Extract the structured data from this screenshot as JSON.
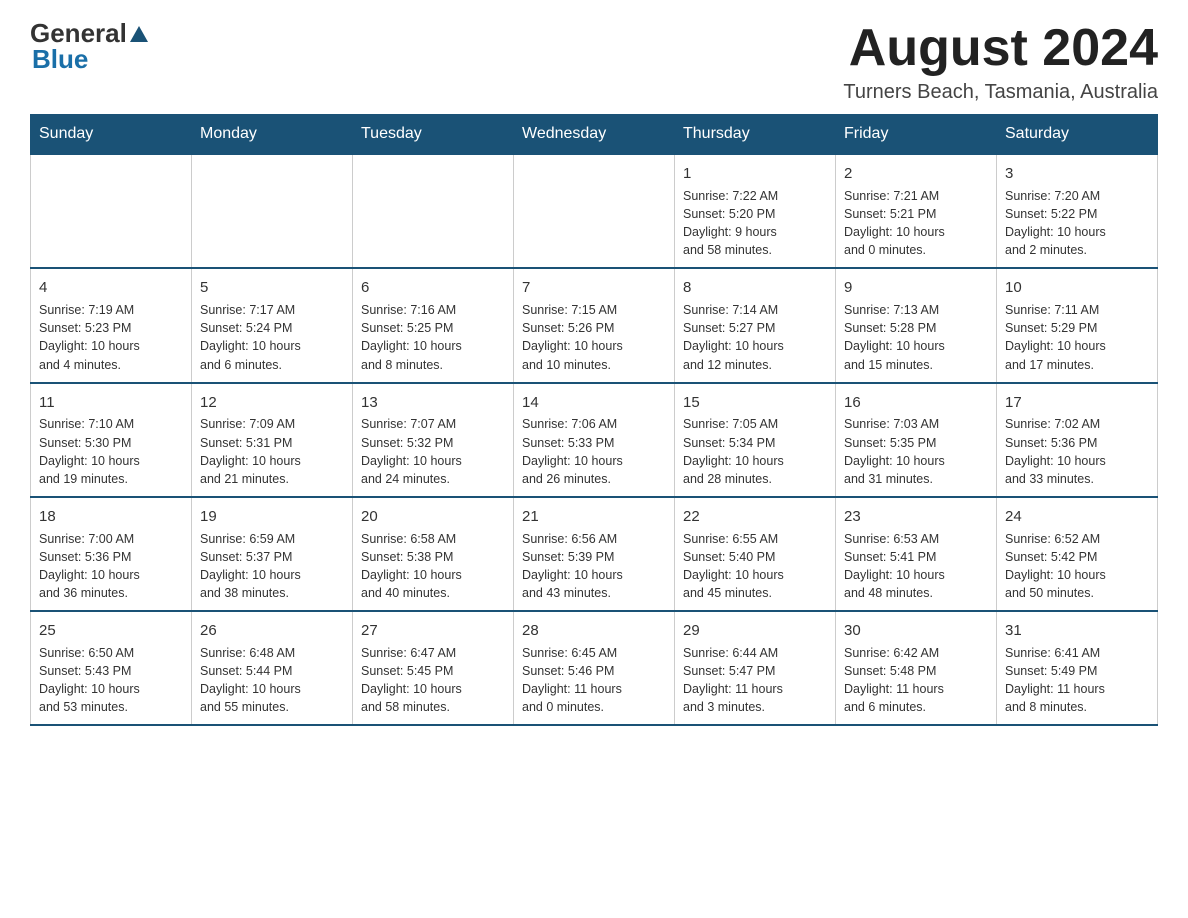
{
  "header": {
    "logo": {
      "general": "General",
      "blue": "Blue"
    },
    "title": "August 2024",
    "location": "Turners Beach, Tasmania, Australia"
  },
  "calendar": {
    "days_of_week": [
      "Sunday",
      "Monday",
      "Tuesday",
      "Wednesday",
      "Thursday",
      "Friday",
      "Saturday"
    ],
    "weeks": [
      [
        {
          "day": "",
          "info": ""
        },
        {
          "day": "",
          "info": ""
        },
        {
          "day": "",
          "info": ""
        },
        {
          "day": "",
          "info": ""
        },
        {
          "day": "1",
          "info": "Sunrise: 7:22 AM\nSunset: 5:20 PM\nDaylight: 9 hours\nand 58 minutes."
        },
        {
          "day": "2",
          "info": "Sunrise: 7:21 AM\nSunset: 5:21 PM\nDaylight: 10 hours\nand 0 minutes."
        },
        {
          "day": "3",
          "info": "Sunrise: 7:20 AM\nSunset: 5:22 PM\nDaylight: 10 hours\nand 2 minutes."
        }
      ],
      [
        {
          "day": "4",
          "info": "Sunrise: 7:19 AM\nSunset: 5:23 PM\nDaylight: 10 hours\nand 4 minutes."
        },
        {
          "day": "5",
          "info": "Sunrise: 7:17 AM\nSunset: 5:24 PM\nDaylight: 10 hours\nand 6 minutes."
        },
        {
          "day": "6",
          "info": "Sunrise: 7:16 AM\nSunset: 5:25 PM\nDaylight: 10 hours\nand 8 minutes."
        },
        {
          "day": "7",
          "info": "Sunrise: 7:15 AM\nSunset: 5:26 PM\nDaylight: 10 hours\nand 10 minutes."
        },
        {
          "day": "8",
          "info": "Sunrise: 7:14 AM\nSunset: 5:27 PM\nDaylight: 10 hours\nand 12 minutes."
        },
        {
          "day": "9",
          "info": "Sunrise: 7:13 AM\nSunset: 5:28 PM\nDaylight: 10 hours\nand 15 minutes."
        },
        {
          "day": "10",
          "info": "Sunrise: 7:11 AM\nSunset: 5:29 PM\nDaylight: 10 hours\nand 17 minutes."
        }
      ],
      [
        {
          "day": "11",
          "info": "Sunrise: 7:10 AM\nSunset: 5:30 PM\nDaylight: 10 hours\nand 19 minutes."
        },
        {
          "day": "12",
          "info": "Sunrise: 7:09 AM\nSunset: 5:31 PM\nDaylight: 10 hours\nand 21 minutes."
        },
        {
          "day": "13",
          "info": "Sunrise: 7:07 AM\nSunset: 5:32 PM\nDaylight: 10 hours\nand 24 minutes."
        },
        {
          "day": "14",
          "info": "Sunrise: 7:06 AM\nSunset: 5:33 PM\nDaylight: 10 hours\nand 26 minutes."
        },
        {
          "day": "15",
          "info": "Sunrise: 7:05 AM\nSunset: 5:34 PM\nDaylight: 10 hours\nand 28 minutes."
        },
        {
          "day": "16",
          "info": "Sunrise: 7:03 AM\nSunset: 5:35 PM\nDaylight: 10 hours\nand 31 minutes."
        },
        {
          "day": "17",
          "info": "Sunrise: 7:02 AM\nSunset: 5:36 PM\nDaylight: 10 hours\nand 33 minutes."
        }
      ],
      [
        {
          "day": "18",
          "info": "Sunrise: 7:00 AM\nSunset: 5:36 PM\nDaylight: 10 hours\nand 36 minutes."
        },
        {
          "day": "19",
          "info": "Sunrise: 6:59 AM\nSunset: 5:37 PM\nDaylight: 10 hours\nand 38 minutes."
        },
        {
          "day": "20",
          "info": "Sunrise: 6:58 AM\nSunset: 5:38 PM\nDaylight: 10 hours\nand 40 minutes."
        },
        {
          "day": "21",
          "info": "Sunrise: 6:56 AM\nSunset: 5:39 PM\nDaylight: 10 hours\nand 43 minutes."
        },
        {
          "day": "22",
          "info": "Sunrise: 6:55 AM\nSunset: 5:40 PM\nDaylight: 10 hours\nand 45 minutes."
        },
        {
          "day": "23",
          "info": "Sunrise: 6:53 AM\nSunset: 5:41 PM\nDaylight: 10 hours\nand 48 minutes."
        },
        {
          "day": "24",
          "info": "Sunrise: 6:52 AM\nSunset: 5:42 PM\nDaylight: 10 hours\nand 50 minutes."
        }
      ],
      [
        {
          "day": "25",
          "info": "Sunrise: 6:50 AM\nSunset: 5:43 PM\nDaylight: 10 hours\nand 53 minutes."
        },
        {
          "day": "26",
          "info": "Sunrise: 6:48 AM\nSunset: 5:44 PM\nDaylight: 10 hours\nand 55 minutes."
        },
        {
          "day": "27",
          "info": "Sunrise: 6:47 AM\nSunset: 5:45 PM\nDaylight: 10 hours\nand 58 minutes."
        },
        {
          "day": "28",
          "info": "Sunrise: 6:45 AM\nSunset: 5:46 PM\nDaylight: 11 hours\nand 0 minutes."
        },
        {
          "day": "29",
          "info": "Sunrise: 6:44 AM\nSunset: 5:47 PM\nDaylight: 11 hours\nand 3 minutes."
        },
        {
          "day": "30",
          "info": "Sunrise: 6:42 AM\nSunset: 5:48 PM\nDaylight: 11 hours\nand 6 minutes."
        },
        {
          "day": "31",
          "info": "Sunrise: 6:41 AM\nSunset: 5:49 PM\nDaylight: 11 hours\nand 8 minutes."
        }
      ]
    ]
  }
}
